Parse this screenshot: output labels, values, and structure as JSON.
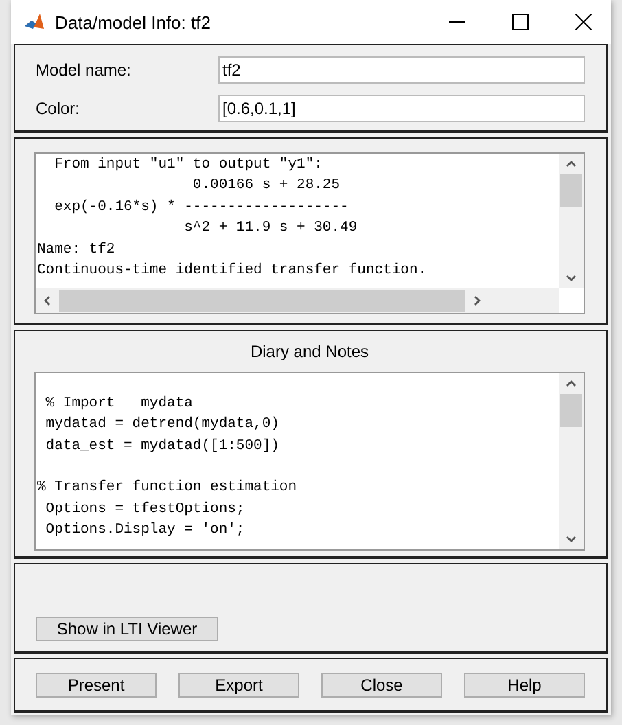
{
  "window": {
    "title": "Data/model Info: tf2"
  },
  "fields": [
    {
      "label": "Model name:",
      "value": "tf2"
    },
    {
      "label": "Color:",
      "value": "[0.6,0.1,1]"
    }
  ],
  "output": {
    "lines": [
      "  From input \"u1\" to output \"y1\":",
      "                  0.00166 s + 28.25",
      "  exp(-0.16*s) * -------------------",
      "                 s^2 + 11.9 s + 30.49",
      "Name: tf2",
      "Continuous-time identified transfer function."
    ]
  },
  "diary": {
    "title": "Diary and Notes",
    "blocks": [
      [
        " % Import   mydata",
        " mydatad = detrend(mydata,0)",
        " data_est = mydatad([1:500])"
      ],
      [
        "% Transfer function estimation",
        " Options = tfestOptions;",
        " Options.Display = 'on';"
      ]
    ]
  },
  "viewer_button": "Show in LTI Viewer",
  "buttons": [
    "Present",
    "Export",
    "Close",
    "Help"
  ]
}
